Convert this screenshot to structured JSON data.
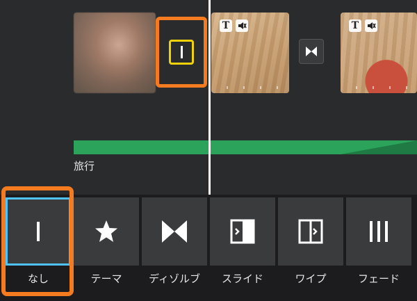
{
  "timeline": {
    "audio_label": "旅行",
    "clip_icons": {
      "text": "T",
      "mute": "🔇"
    }
  },
  "toolbar": {
    "items": [
      {
        "label": "なし",
        "icon": "line-icon"
      },
      {
        "label": "テーマ",
        "icon": "star-icon"
      },
      {
        "label": "ディゾルブ",
        "icon": "bowtie-icon"
      },
      {
        "label": "スライド",
        "icon": "slide-icon"
      },
      {
        "label": "ワイプ",
        "icon": "wipe-icon"
      },
      {
        "label": "フェード",
        "icon": "fade-icon"
      }
    ],
    "selected_index": 0
  },
  "colors": {
    "highlight_orange": "#f47b20",
    "selected_blue": "#4fc3ff",
    "audio_green": "#2ca35a",
    "transition_yellow": "#f1d20a"
  }
}
